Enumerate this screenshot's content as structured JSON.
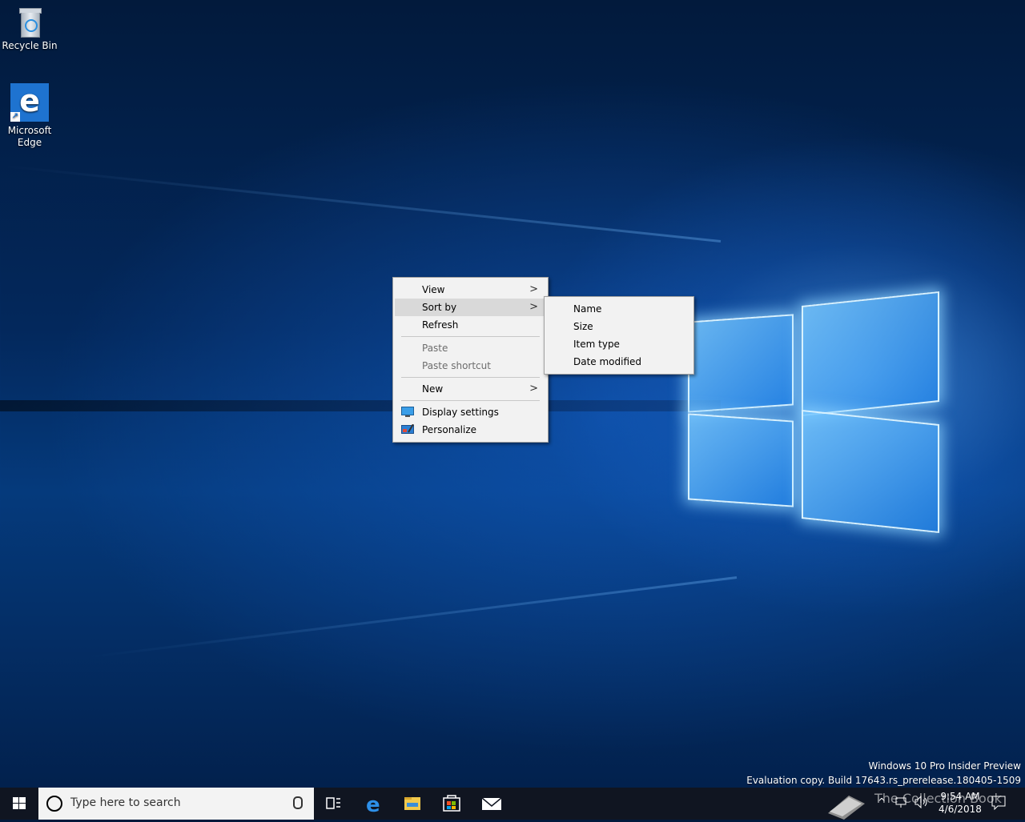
{
  "desktop_icons": [
    {
      "label": "Recycle Bin",
      "icon": "recycle-bin-icon"
    },
    {
      "label": "Microsoft\nEdge",
      "icon": "edge-icon"
    }
  ],
  "context_menu": {
    "items": [
      {
        "label": "View",
        "has_submenu": true
      },
      {
        "label": "Sort by",
        "has_submenu": true,
        "highlighted": true
      },
      {
        "label": "Refresh"
      },
      {
        "label": "Paste",
        "disabled": true
      },
      {
        "label": "Paste shortcut",
        "disabled": true
      },
      {
        "label": "New",
        "has_submenu": true
      },
      {
        "label": "Display settings",
        "icon": "display-settings-icon"
      },
      {
        "label": "Personalize",
        "icon": "personalize-icon"
      }
    ]
  },
  "submenu": {
    "items": [
      "Name",
      "Size",
      "Item type",
      "Date modified"
    ]
  },
  "watermark": {
    "line1": "Windows 10 Pro Insider Preview",
    "line2": "Evaluation copy. Build 17643.rs_prerelease.180405-1509"
  },
  "taskbar": {
    "search_placeholder": "Type here to search",
    "pinned": [
      "task-view-icon",
      "edge-icon",
      "file-explorer-icon",
      "store-icon",
      "mail-icon"
    ],
    "clock_time": "9:54 AM",
    "clock_date": "4/6/2018",
    "overlay_text": "The Collection Book"
  },
  "colors": {
    "accent": "#1e73d0",
    "taskbar": "#101521",
    "menu_bg": "#f2f2f2",
    "menu_hover": "#d9d9d9"
  }
}
